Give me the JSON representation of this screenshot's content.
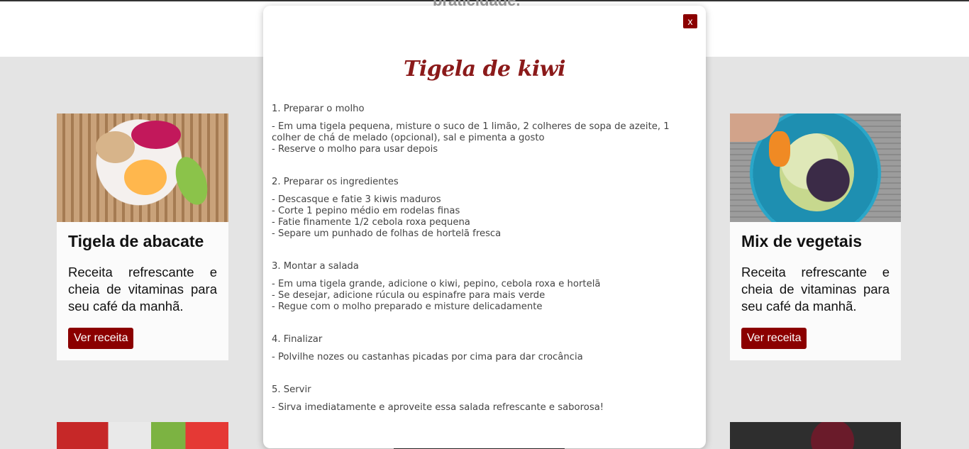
{
  "header": {
    "partial_text": "praticidade."
  },
  "cards": [
    {
      "title": "Tigela de abacate",
      "description": "Receita refrescante e cheia de vitaminas para seu café da manhã.",
      "button": "Ver receita"
    },
    {
      "title": "Mix de vegetais",
      "description": "Receita refrescante e cheia de vitaminas para seu café da manhã.",
      "button": "Ver receita"
    }
  ],
  "modal": {
    "close_label": "x",
    "title": "Tigela de kiwi",
    "steps": [
      {
        "title": "1. Preparar o molho",
        "lines": [
          "- Em uma tigela pequena, misture o suco de 1 limão, 2 colheres de sopa de azeite, 1 colher de chá de melado (opcional), sal e pimenta a gosto",
          "- Reserve o molho para usar depois"
        ]
      },
      {
        "title": "2. Preparar os ingredientes",
        "lines": [
          "- Descasque e fatie 3 kiwis maduros",
          "- Corte 1 pepino médio em rodelas finas",
          "- Fatie finamente 1/2 cebola roxa pequena",
          "- Separe um punhado de folhas de hortelã fresca"
        ]
      },
      {
        "title": "3. Montar a salada",
        "lines": [
          "- Em uma tigela grande, adicione o kiwi, pepino, cebola roxa e hortelã",
          "- Se desejar, adicione rúcula ou espinafre para mais verde",
          "- Regue com o molho preparado e misture delicadamente"
        ]
      },
      {
        "title": "4. Finalizar",
        "lines": [
          "- Polvilhe nozes ou castanhas picadas por cima para dar crocância"
        ]
      },
      {
        "title": "5. Servir",
        "lines": [
          "- Sirva imediatamente e aproveite essa salada refrescante e saborosa!"
        ]
      }
    ]
  },
  "colors": {
    "accent": "#8b0000",
    "page_bg": "#e4e4e4"
  }
}
